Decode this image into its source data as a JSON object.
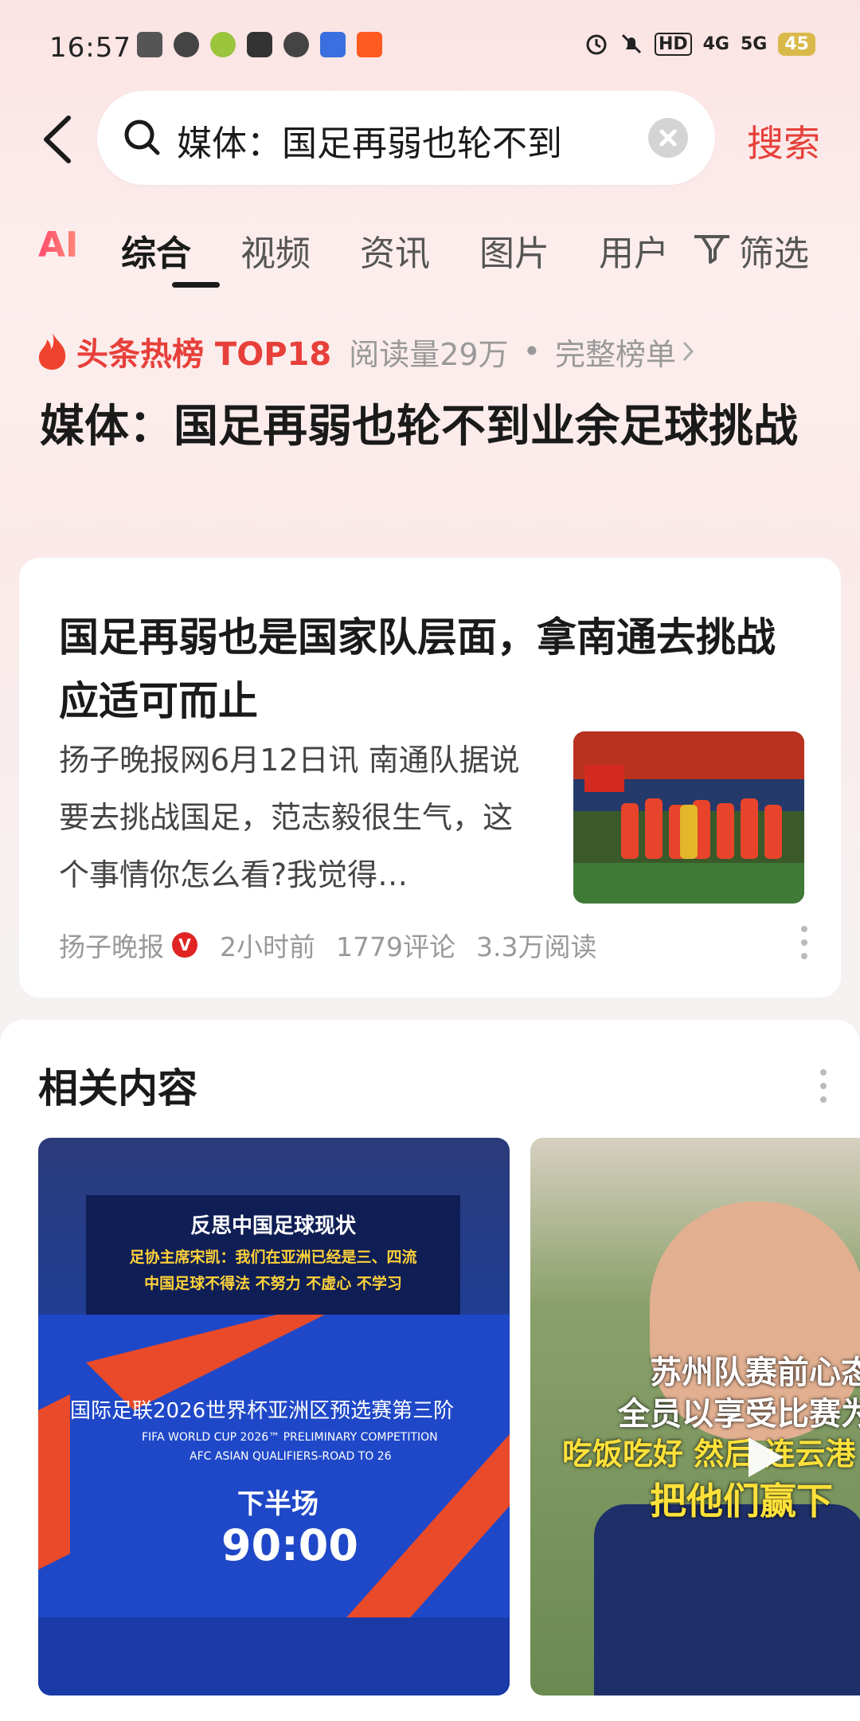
{
  "status_bar": {
    "time": "16:57",
    "left_icons": [
      "toutiao-icon",
      "wechat-icon",
      "app-icon",
      "video-icon",
      "link-icon",
      "baidu-icon",
      "taobao-icon"
    ],
    "right_icons": [
      "alarm-icon",
      "mute-icon",
      "hd-icon",
      "signal-4g-icon",
      "signal-5g-icon"
    ],
    "hd_label": "HD",
    "net1_label": "4G",
    "net2_label": "5G",
    "battery": "45"
  },
  "header": {
    "back_icon": "back-icon",
    "search_value": "媒体：国足再弱也轮不到业余",
    "search_button": "搜索"
  },
  "tabs": {
    "ai": "AI",
    "items": [
      "综合",
      "视频",
      "资讯",
      "图片",
      "用户"
    ],
    "active": "综合",
    "filter": "筛选"
  },
  "hot": {
    "title": "头条热榜 TOP18",
    "read_count": "阅读量29万",
    "separator": "•",
    "full_list": "完整榜单",
    "headline": "媒体：国足再弱也轮不到业余足球挑战"
  },
  "article": {
    "title": "国足再弱也是国家队层面，拿南通去挑战应适可而止",
    "excerpt": "扬子晚报网6月12日讯 南通队据说要去挑战国足，范志毅很生气，这个事情你怎么看?我觉得…",
    "source": "扬子晚报",
    "verified_badge": "V",
    "time": "2小时前",
    "comments": "1779评论",
    "reads": "3.3万阅读"
  },
  "related": {
    "title": "相关内容",
    "items": [
      {
        "lines": [
          "反思中国足球现状",
          "足协主席宋凯：我们在亚洲已经是三、四流",
          "中国足球不得法 不努力 不虚心 不学习"
        ],
        "board_title": "国际足联2026世界杯亚洲区预选赛第三阶",
        "board_sub1": "FIFA WORLD CUP 2026™ PRELIMINARY COMPETITION",
        "board_sub2": "AFC ASIAN QUALIFIERS-ROAD TO 26",
        "half_label": "下半场",
        "clock": "90:00"
      },
      {
        "line1": "苏州队赛前心态",
        "line2": "全员以享受比赛为",
        "line3": "吃饭吃好 然后 连云港",
        "line4": "把他们赢下"
      }
    ]
  }
}
